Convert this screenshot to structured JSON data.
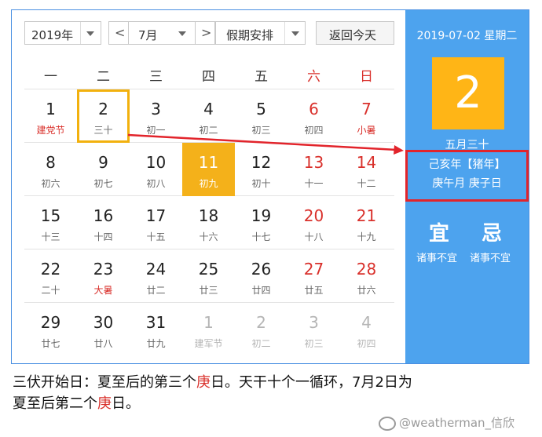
{
  "controls": {
    "year": "2019年",
    "month": "7月",
    "prev": "<",
    "next": ">",
    "holiday": "假期安排",
    "today_button": "返回今天"
  },
  "weekdays": [
    "一",
    "二",
    "三",
    "四",
    "五",
    "六",
    "日"
  ],
  "days": [
    {
      "num": "1",
      "lunar": "建党节"
    },
    {
      "num": "2",
      "lunar": "三十"
    },
    {
      "num": "3",
      "lunar": "初一"
    },
    {
      "num": "4",
      "lunar": "初二"
    },
    {
      "num": "5",
      "lunar": "初三"
    },
    {
      "num": "6",
      "lunar": "初四"
    },
    {
      "num": "7",
      "lunar": "小暑"
    },
    {
      "num": "8",
      "lunar": "初六"
    },
    {
      "num": "9",
      "lunar": "初七"
    },
    {
      "num": "10",
      "lunar": "初八"
    },
    {
      "num": "11",
      "lunar": "初九"
    },
    {
      "num": "12",
      "lunar": "初十"
    },
    {
      "num": "13",
      "lunar": "十一"
    },
    {
      "num": "14",
      "lunar": "十二"
    },
    {
      "num": "15",
      "lunar": "十三"
    },
    {
      "num": "16",
      "lunar": "十四"
    },
    {
      "num": "17",
      "lunar": "十五"
    },
    {
      "num": "18",
      "lunar": "十六"
    },
    {
      "num": "19",
      "lunar": "十七"
    },
    {
      "num": "20",
      "lunar": "十八"
    },
    {
      "num": "21",
      "lunar": "十九"
    },
    {
      "num": "22",
      "lunar": "二十"
    },
    {
      "num": "23",
      "lunar": "大暑"
    },
    {
      "num": "24",
      "lunar": "廿二"
    },
    {
      "num": "25",
      "lunar": "廿三"
    },
    {
      "num": "26",
      "lunar": "廿四"
    },
    {
      "num": "27",
      "lunar": "廿五"
    },
    {
      "num": "28",
      "lunar": "廿六"
    },
    {
      "num": "29",
      "lunar": "廿七"
    },
    {
      "num": "30",
      "lunar": "廿八"
    },
    {
      "num": "31",
      "lunar": "廿九"
    },
    {
      "num": "1",
      "lunar": "建军节"
    },
    {
      "num": "2",
      "lunar": "初二"
    },
    {
      "num": "3",
      "lunar": "初三"
    },
    {
      "num": "4",
      "lunar": "初四"
    }
  ],
  "panel": {
    "date_line": "2019-07-02 星期二",
    "big_day": "2",
    "lunar_date": "五月三十",
    "ganzhi_year": "己亥年【猪年】",
    "ganzhi_daymonth": "庚午月 庚子日",
    "yi": "宜",
    "ji": "忌",
    "yi_text": "诸事不宜",
    "ji_text": "诸事不宜"
  },
  "caption": {
    "part1": "三伏开始日：夏至后的第三个",
    "geng1": "庚",
    "part2": "日。天干十个一循环，7月2日为",
    "part3": "夏至后第二个",
    "geng2": "庚",
    "part4": "日。"
  },
  "watermark": "@weatherman_信欣",
  "colors": {
    "accent_blue": "#4da3ee",
    "today_orange": "#f4b11a",
    "highlight_red": "#e2242b",
    "weekend_red": "#d9302b"
  }
}
